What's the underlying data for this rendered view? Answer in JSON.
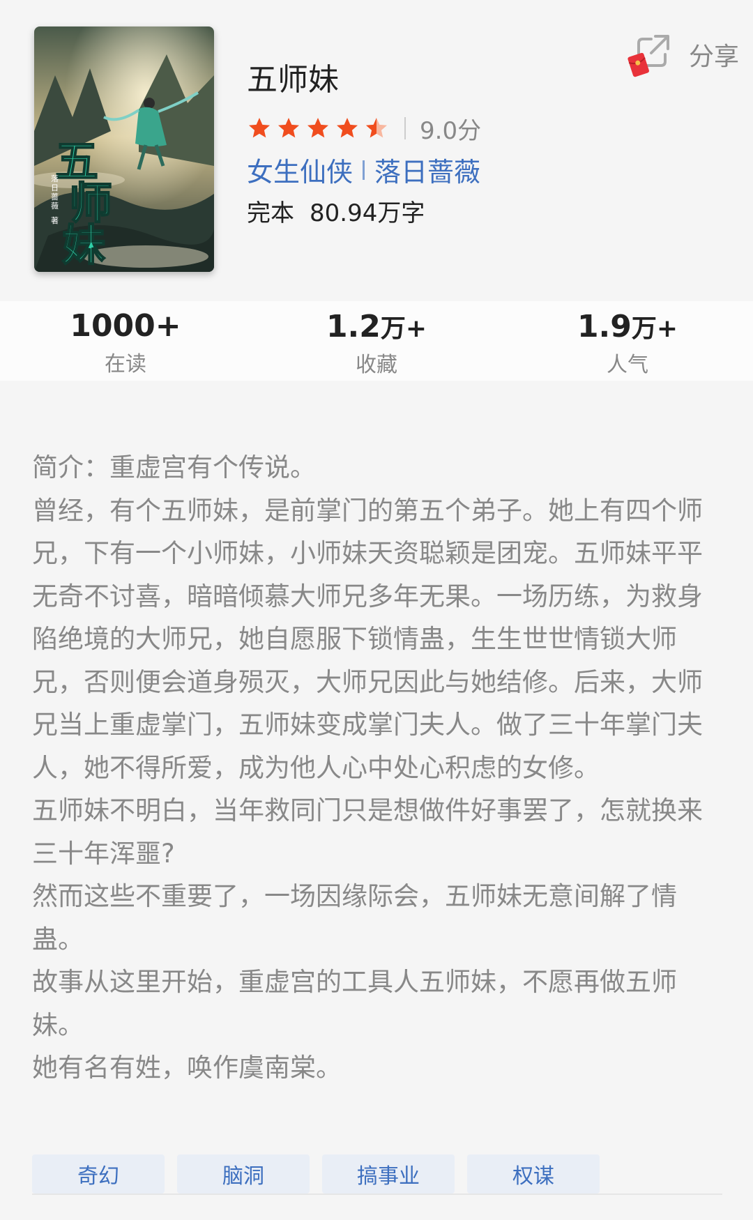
{
  "book": {
    "title": "五师妹",
    "cover": {
      "big_title": "五师妹",
      "author_vertical": "落日蔷薇",
      "author_suffix": "著"
    },
    "rating": {
      "stars": 4.5,
      "max_stars": 5,
      "score_text": "9.0分"
    },
    "category": "女生仙侠",
    "author": "落日蔷薇",
    "status": "完本",
    "word_count": "80.94万字"
  },
  "share": {
    "label": "分享",
    "icon": "share-icon",
    "badge_icon": "red-envelope-icon"
  },
  "stats": [
    {
      "value": "1000+",
      "unit": "",
      "label": "在读"
    },
    {
      "value": "1.2",
      "unit": "万+",
      "label": "收藏"
    },
    {
      "value": "1.9",
      "unit": "万+",
      "label": "人气"
    }
  ],
  "intro": {
    "paragraphs": [
      "简介：重虚宫有个传说。",
      "曾经，有个五师妹，是前掌门的第五个弟子。她上有四个师兄，下有一个小师妹，小师妹天资聪颖是团宠。五师妹平平无奇不讨喜，暗暗倾慕大师兄多年无果。一场历练，为救身陷绝境的大师兄，她自愿服下锁情蛊，生生世世情锁大师兄，否则便会道身殒灭，大师兄因此与她结修。后来，大师兄当上重虚掌门，五师妹变成掌门夫人。做了三十年掌门夫人，她不得所爱，成为他人心中处心积虑的女修。",
      "五师妹不明白，当年救同门只是想做件好事罢了，怎就换来三十年浑噩?",
      "然而这些不重要了，一场因缘际会，五师妹无意间解了情蛊。",
      "故事从这里开始，重虚宫的工具人五师妹，不愿再做五师妹。",
      "她有名有姓，唤作虞南棠。"
    ]
  },
  "tags": [
    "奇幻",
    "脑洞",
    "搞事业",
    "权谋"
  ],
  "colors": {
    "accent_blue": "#3d6fbf",
    "star_orange": "#f04d1e",
    "muted_text": "#888888"
  }
}
